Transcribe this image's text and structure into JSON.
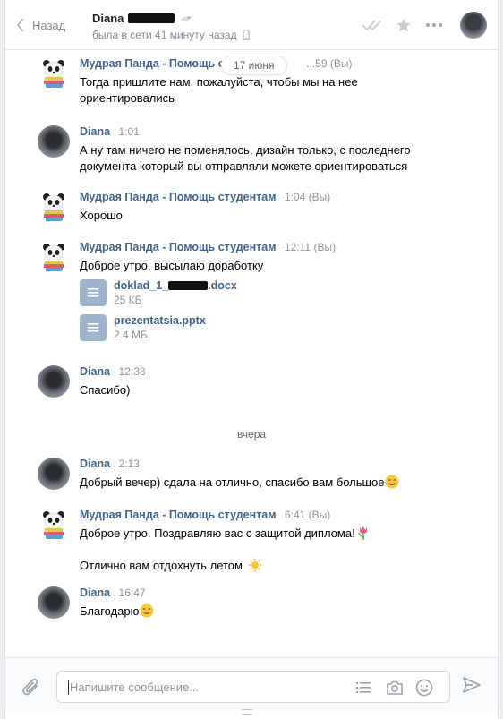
{
  "header": {
    "back_label": "Назад",
    "peer_name": "Diana",
    "peer_status": "была в сети 41 минуту назад"
  },
  "date_separators": {
    "first": "17 июня",
    "second": "вчера"
  },
  "messages": [
    {
      "author": "Мудрая Панда - Помощь с",
      "time": "...59 (Вы)",
      "text": [
        "Тогда пришлите нам, пожалуйста, чтобы мы на нее",
        "ориентировались"
      ]
    },
    {
      "author": "Diana",
      "time": "1:01",
      "text": [
        "А ну там ничего не поменялось, дизайн только, с последнего",
        "документа который вы отправляли можете ориентироваться"
      ]
    },
    {
      "author": "Мудрая Панда - Помощь студентам",
      "time": "1:04 (Вы)",
      "text": [
        "Хорошо"
      ]
    },
    {
      "author": "Мудрая Панда - Помощь студентам",
      "time": "12:11 (Вы)",
      "text": [
        "Доброе утро, высылаю доработку"
      ],
      "docs": [
        {
          "name_prefix": "doklad_1_",
          "name_suffix": ".docx",
          "size": "25 КБ"
        },
        {
          "name": "prezentatsia.pptx",
          "size": "2.4 МБ"
        }
      ]
    },
    {
      "author": "Diana",
      "time": "12:38",
      "text": [
        "Спасибо)"
      ]
    },
    {
      "author": "Diana",
      "time": "2:13",
      "text": [
        "Добрый вечер) сдала на отлично, спасибо вам большое"
      ]
    },
    {
      "author": "Мудрая Панда - Помощь студентам",
      "time": "6:41 (Вы)",
      "text": [
        "Доброе утро. Поздравляю вас с защитой диплома!",
        "Отлично вам отдохнуть летом"
      ]
    },
    {
      "author": "Diana",
      "time": "16:47",
      "text": [
        "Благодарю"
      ]
    }
  ],
  "composer": {
    "placeholder": "Напишите сообщение..."
  },
  "colors": {
    "link": "#42648b",
    "muted": "#939393",
    "doc_icon": "#9eb4cd",
    "background": "#edeef0"
  },
  "icons": [
    "chevron-left-icon",
    "phone-icon",
    "double-check-icon",
    "star-icon",
    "more-icon",
    "paperclip-icon",
    "list-icon",
    "camera-icon",
    "smile-icon",
    "send-icon",
    "document-icon",
    "smile-emoji",
    "tulip-emoji",
    "sun-emoji"
  ]
}
